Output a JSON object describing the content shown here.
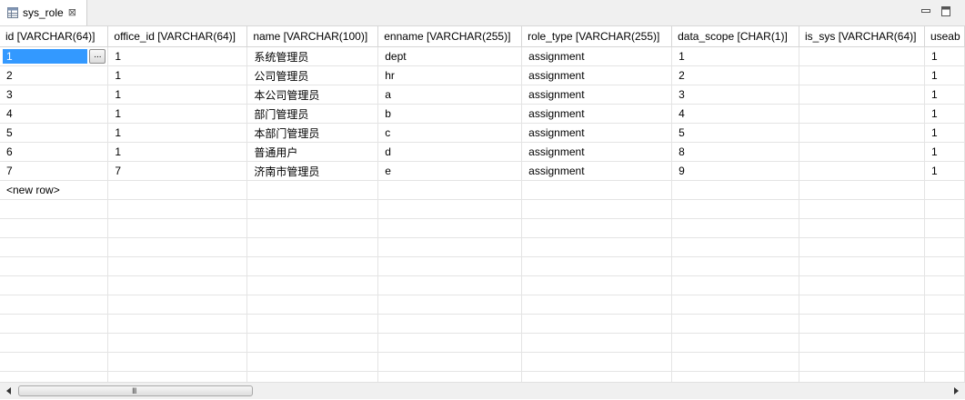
{
  "tab": {
    "title": "sys_role",
    "icon": "table-icon",
    "close_glyph": "⊠"
  },
  "window_controls": {
    "minimize_icon": "minimize-icon",
    "maximize_icon": "maximize-icon"
  },
  "grid": {
    "columns": [
      "id [VARCHAR(64)]",
      "office_id [VARCHAR(64)]",
      "name [VARCHAR(100)]",
      "enname [VARCHAR(255)]",
      "role_type [VARCHAR(255)]",
      "data_scope [CHAR(1)]",
      "is_sys [VARCHAR(64)]",
      "useab"
    ],
    "rows": [
      [
        "1",
        "1",
        "系统管理员",
        "dept",
        "assignment",
        "1",
        "",
        "1"
      ],
      [
        "2",
        "1",
        "公司管理员",
        "hr",
        "assignment",
        "2",
        "",
        "1"
      ],
      [
        "3",
        "1",
        "本公司管理员",
        "a",
        "assignment",
        "3",
        "",
        "1"
      ],
      [
        "4",
        "1",
        "部门管理员",
        "b",
        "assignment",
        "4",
        "",
        "1"
      ],
      [
        "5",
        "1",
        "本部门管理员",
        "c",
        "assignment",
        "5",
        "",
        "1"
      ],
      [
        "6",
        "1",
        "普通用户",
        "d",
        "assignment",
        "8",
        "",
        "1"
      ],
      [
        "7",
        "7",
        "济南市管理员",
        "e",
        "assignment",
        "9",
        "",
        "1"
      ]
    ],
    "new_row_label": "<new row>",
    "ellipsis_label": "...",
    "selected_cell": {
      "row": 0,
      "col": 0
    }
  },
  "scrollbar": {
    "grip": "III"
  }
}
